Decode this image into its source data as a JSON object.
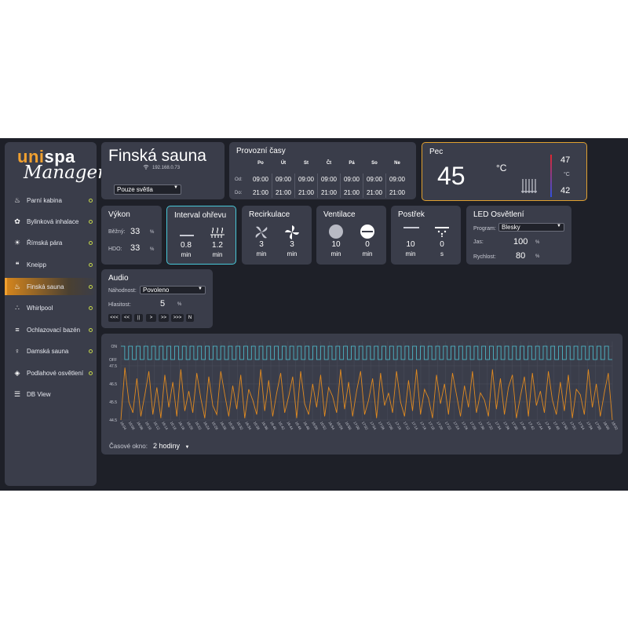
{
  "sidebar": {
    "logo_part1": "uni",
    "logo_part2": "spa",
    "logo_part3": "Manager",
    "items": [
      {
        "label": "Parní kabina",
        "icon": "steam-cabin-icon"
      },
      {
        "label": "Bylinková inhalace",
        "icon": "herb-leaf-icon"
      },
      {
        "label": "Římská pára",
        "icon": "sun-icon"
      },
      {
        "label": "Kneipp",
        "icon": "footprints-icon"
      },
      {
        "label": "Finská sauna",
        "icon": "sauna-icon",
        "active": true
      },
      {
        "label": "Whirlpool",
        "icon": "bubbles-icon"
      },
      {
        "label": "Ochlazovací bazén",
        "icon": "pool-ladder-icon"
      },
      {
        "label": "Damská sauna",
        "icon": "woman-icon"
      },
      {
        "label": "Podlahové osvětlení",
        "icon": "floor-light-icon"
      },
      {
        "label": "DB View",
        "icon": "database-icon"
      }
    ]
  },
  "header": {
    "title": "Finská sauna",
    "ip": "192.168.0.73",
    "mode_select": "Pouze světla"
  },
  "schedule": {
    "title": "Provozní časy",
    "days": [
      "Po",
      "Út",
      "St",
      "Čt",
      "Pá",
      "So",
      "Ne"
    ],
    "from_label": "Od:",
    "to_label": "Do:",
    "from": [
      "09:00",
      "09:00",
      "09:00",
      "09:00",
      "09:00",
      "09:00",
      "09:00"
    ],
    "to": [
      "21:00",
      "21:00",
      "21:00",
      "21:00",
      "21:00",
      "21:00",
      "21:00"
    ]
  },
  "oven": {
    "title": "Pec",
    "temp": "45",
    "unit": "°C",
    "max": "47",
    "range_unit": "°C",
    "min": "42"
  },
  "vykon": {
    "title": "Výkon",
    "row1_label": "Běžný:",
    "row1_value": "33",
    "row1_unit": "%",
    "row2_label": "HDO:",
    "row2_value": "33",
    "row2_unit": "%"
  },
  "interval": {
    "title": "Interval ohřevu",
    "a_value": "0.8",
    "a_unit": "min",
    "b_value": "1.2",
    "b_unit": "min"
  },
  "recirc": {
    "title": "Recirkulace",
    "a_value": "3",
    "a_unit": "min",
    "b_value": "3",
    "b_unit": "min"
  },
  "vent": {
    "title": "Ventilace",
    "a_value": "10",
    "a_unit": "min",
    "b_value": "0",
    "b_unit": "min"
  },
  "spray": {
    "title": "Postřek",
    "a_value": "10",
    "a_unit": "min",
    "b_value": "0",
    "b_unit": "s"
  },
  "led": {
    "title": "LED Osvětlení",
    "program_label": "Program:",
    "program": "Blesky",
    "jas_label": "Jas:",
    "jas": "100",
    "jas_unit": "%",
    "speed_label": "Rychlost:",
    "speed": "80",
    "speed_unit": "%"
  },
  "audio": {
    "title": "Audio",
    "random_label": "Náhodnost:",
    "random": "Povoleno",
    "volume_label": "Hlasitost:",
    "volume": "5",
    "volume_unit": "%",
    "buttons": [
      "<<<",
      "<<",
      "||",
      ">",
      ">>",
      ">>>",
      "N"
    ]
  },
  "chart_data": {
    "type": "line",
    "y_labels": [
      "ON",
      "OFF",
      "47.5",
      "46.5",
      "45.5",
      "44.5"
    ],
    "x_ticks": [
      "16:04",
      "16:06",
      "16:08",
      "16:10",
      "16:12",
      "16:14",
      "16:16",
      "16:18",
      "16:20",
      "16:22",
      "16:24",
      "16:26",
      "16:28",
      "16:30",
      "16:32",
      "16:34",
      "16:36",
      "16:38",
      "16:40",
      "16:42",
      "16:44",
      "16:46",
      "16:48",
      "16:50",
      "16:52",
      "16:54",
      "16:56",
      "16:58",
      "17:00",
      "17:02",
      "17:04",
      "17:06",
      "17:08",
      "17:10",
      "17:12",
      "17:14",
      "17:16",
      "17:18",
      "17:20",
      "17:22",
      "17:24",
      "17:26",
      "17:28",
      "17:30",
      "17:32",
      "17:34",
      "17:36",
      "17:38",
      "17:40",
      "17:42",
      "17:44",
      "17:46",
      "17:48",
      "17:50",
      "17:52",
      "17:54",
      "17:56",
      "17:58",
      "18:00",
      "18:02"
    ],
    "series": [
      {
        "values": [
          44.5,
          47.4,
          45.5,
          44.9,
          46.8,
          44.7,
          45.9,
          47.2,
          44.8,
          46.3,
          44.6,
          47.0,
          45.2,
          46.6,
          44.7,
          47.3,
          45.0,
          46.1,
          44.9,
          47.1,
          45.7,
          44.6,
          46.9,
          45.3,
          44.8,
          47.2,
          45.9,
          44.7,
          46.4,
          45.1,
          47.0,
          44.6,
          46.2,
          45.6,
          44.8,
          47.3,
          45.0,
          46.7,
          44.7,
          46.0,
          47.1,
          44.9,
          45.8,
          46.9,
          44.6,
          47.2,
          45.4,
          44.8,
          46.5,
          45.2,
          47.0,
          44.7,
          46.3,
          45.8,
          44.9,
          47.3,
          45.1,
          46.6,
          44.7,
          46.1,
          47.2,
          44.8,
          45.6,
          46.8,
          44.6,
          47.1,
          45.3,
          46.0,
          44.9,
          47.2,
          45.5,
          44.7,
          46.7,
          45.0,
          47.3,
          44.8,
          46.2,
          45.7,
          44.6,
          47.0,
          45.4,
          46.5,
          44.8,
          47.1,
          45.9,
          44.7,
          46.4,
          45.2,
          47.2,
          44.9,
          46.0,
          45.6,
          44.7,
          47.3,
          45.1,
          46.8,
          44.8,
          46.3,
          47.0,
          44.6,
          45.8,
          46.9,
          44.7,
          47.1,
          45.3,
          46.1,
          44.9,
          47.2,
          45.6,
          44.8,
          46.6,
          45.0,
          47.0,
          44.6,
          46.2,
          45.9,
          44.8,
          47.3,
          45.2,
          46.5,
          44.7,
          46.0,
          47.1,
          44.5
        ]
      },
      {
        "values": [
          1,
          0,
          1,
          0,
          1,
          0,
          1,
          0,
          1,
          0,
          1,
          0,
          1,
          0,
          1,
          0,
          1,
          0,
          1,
          0,
          1,
          0,
          1,
          0,
          1,
          0,
          1,
          0,
          1,
          0,
          1,
          0,
          1,
          0,
          1,
          0,
          1,
          0,
          1,
          0,
          1,
          0,
          1,
          0,
          1,
          0,
          1,
          0,
          1,
          0,
          1,
          0,
          1,
          0,
          1,
          0,
          1,
          0,
          1,
          0,
          1,
          0,
          1,
          0,
          1,
          0,
          1,
          0,
          1,
          0,
          1,
          0,
          1,
          0,
          1,
          0,
          1,
          0,
          1,
          0,
          1,
          0,
          1,
          0,
          1,
          0,
          1,
          0,
          1,
          0,
          1,
          0,
          1,
          0,
          1,
          0,
          1,
          0,
          1,
          0,
          1,
          0,
          1,
          0,
          1,
          0,
          1,
          0,
          1,
          0,
          1,
          0,
          1,
          0,
          1,
          0,
          1,
          0,
          1,
          0,
          1,
          0,
          1,
          0,
          1,
          0,
          1,
          0
        ]
      }
    ],
    "colors": {
      "temp": "#e08a20",
      "state": "#4ec4d4",
      "grid": "#4a4e5c"
    },
    "window_label": "Časové okno:",
    "window_value": "2 hodiny"
  },
  "colors": {
    "accent": "#f0a030",
    "cyan": "#48c8d8",
    "bg": "#1e2028",
    "card": "#3a3d4a"
  }
}
